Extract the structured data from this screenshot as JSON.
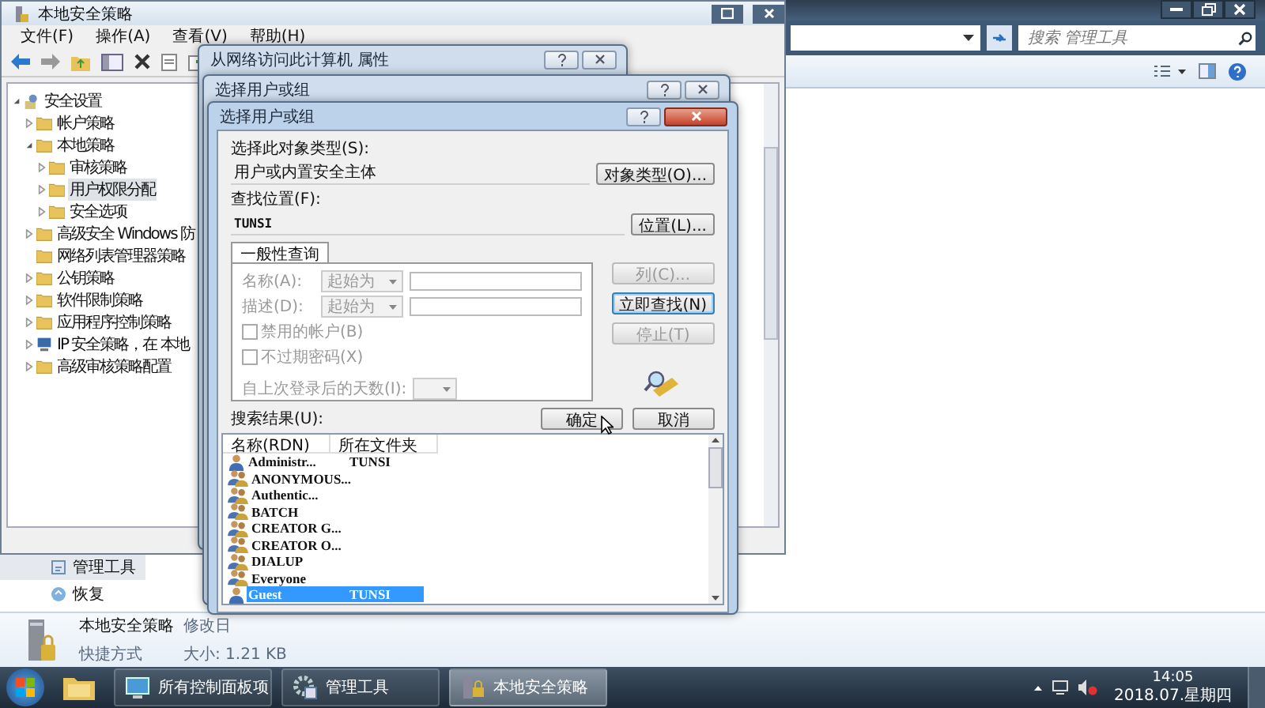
{
  "explorer": {
    "search_placeholder": "搜索 管理工具",
    "nav_items": [
      {
        "label": "管理工具",
        "kind": "tools",
        "selected": true
      },
      {
        "label": "恢复",
        "kind": "restore",
        "selected": false
      }
    ],
    "details": {
      "name": "本地安全策略",
      "modified": "修改日",
      "type": "快捷方式",
      "size": "大小: 1.21 KB"
    }
  },
  "secpol": {
    "title": "本地安全策略",
    "menu": [
      "文件(F)",
      "操作(A)",
      "查看(V)",
      "帮助(H)"
    ],
    "tree": [
      {
        "label": "安全设置",
        "kind": "root",
        "expanded": true,
        "selected": false,
        "children": [
          {
            "label": "帐户策略",
            "kind": "folder",
            "expanded": false,
            "selected": false
          },
          {
            "label": "本地策略",
            "kind": "folder",
            "expanded": true,
            "selected": false,
            "children": [
              {
                "label": "审核策略",
                "kind": "folder",
                "expanded": false,
                "selected": false
              },
              {
                "label": "用户权限分配",
                "kind": "folder",
                "expanded": false,
                "selected": true
              },
              {
                "label": "安全选项",
                "kind": "folder",
                "expanded": false,
                "selected": false
              }
            ]
          },
          {
            "label": "高级安全 Windows 防",
            "kind": "folder",
            "expanded": false,
            "selected": false
          },
          {
            "label": "网络列表管理器策略",
            "kind": "folder",
            "selected": false
          },
          {
            "label": "公钥策略",
            "kind": "folder",
            "expanded": false,
            "selected": false
          },
          {
            "label": "软件限制策略",
            "kind": "folder",
            "expanded": false,
            "selected": false
          },
          {
            "label": "应用程序控制策略",
            "kind": "folder",
            "expanded": false,
            "selected": false
          },
          {
            "label": "IP 安全策略，在 本地",
            "kind": "network",
            "expanded": false,
            "selected": false
          },
          {
            "label": "高级审核策略配置",
            "kind": "folder",
            "expanded": false,
            "selected": false
          }
        ]
      }
    ]
  },
  "properties_dialog": {
    "title": "从网络访问此计算机 属性"
  },
  "back_dialog": {
    "title": "选择用户或组"
  },
  "dialog": {
    "title": "选择用户或组",
    "object_type_label": "选择此对象类型(S):",
    "object_type": "用户或内置安全主体",
    "object_type_button": "对象类型(O)...",
    "location_label": "查找位置(F):",
    "location": "TUNSI",
    "location_button": "位置(L)...",
    "tab": "一般性查询",
    "query": {
      "disabled": true,
      "fields": [
        {
          "label": "名称(A):",
          "condition": "起始为"
        },
        {
          "label": "描述(D):",
          "condition": "起始为"
        }
      ],
      "checkboxes": [
        {
          "label": "禁用的帐户(B)",
          "checked": false
        },
        {
          "label": "不过期密码(X)",
          "checked": false
        }
      ],
      "days_label": "自上次登录后的天数(I):"
    },
    "side_buttons": [
      {
        "label": "列(C)...",
        "disabled": true,
        "focused": false
      },
      {
        "label": "立即查找(N)",
        "disabled": false,
        "focused": true
      },
      {
        "label": "停止(T)",
        "disabled": true,
        "focused": false
      }
    ],
    "ok": "确定",
    "cancel": "取消",
    "results_label": "搜索结果(U):",
    "columns": [
      "名称(RDN)",
      "所在文件夹"
    ],
    "rows": [
      {
        "name": "Administr...",
        "folder": "TUNSI",
        "kind": "user",
        "selected": false
      },
      {
        "name": "ANONYMOUS...",
        "kind": "group",
        "selected": false
      },
      {
        "name": "Authentic...",
        "kind": "group",
        "selected": false
      },
      {
        "name": "BATCH",
        "kind": "group",
        "selected": false
      },
      {
        "name": "CREATOR G...",
        "kind": "group",
        "selected": false
      },
      {
        "name": "CREATOR O...",
        "kind": "group",
        "selected": false
      },
      {
        "name": "DIALUP",
        "kind": "group",
        "selected": false
      },
      {
        "name": "Everyone",
        "kind": "group",
        "selected": false
      },
      {
        "name": "Guest",
        "folder": "TUNSI",
        "kind": "user",
        "selected": true
      }
    ]
  },
  "taskbar": {
    "buttons": [
      {
        "label": "所有控制面板项",
        "kind": "control-panel",
        "selected": false
      },
      {
        "label": "管理工具",
        "kind": "tools",
        "selected": false
      },
      {
        "label": "本地安全策略",
        "kind": "secpol",
        "selected": true
      }
    ],
    "time": "14:05",
    "date": "2018.07.星期四"
  }
}
